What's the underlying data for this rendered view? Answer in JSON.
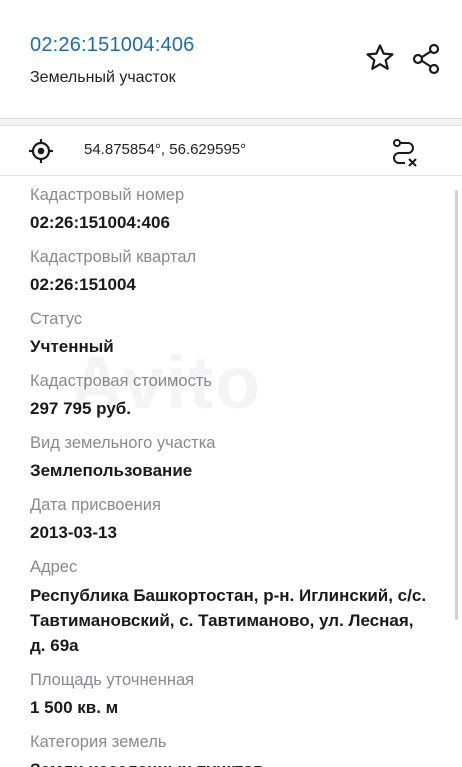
{
  "header": {
    "cadastral_number": "02:26:151004:406",
    "object_type": "Земельный участок"
  },
  "coords": {
    "text": "54.875854°, 56.629595°"
  },
  "fields": [
    {
      "label": "Кадастровый номер",
      "value": "02:26:151004:406"
    },
    {
      "label": "Кадастровый квартал",
      "value": "02:26:151004"
    },
    {
      "label": "Статус",
      "value": "Учтенный"
    },
    {
      "label": "Кадастровая стоимость",
      "value": "297 795 руб."
    },
    {
      "label": "Вид земельного участка",
      "value": "Землепользование"
    },
    {
      "label": "Дата присвоения",
      "value": "2013-03-13"
    },
    {
      "label": "Адрес",
      "value": "Республика Башкортостан, р-н. Иглинский, с/с. Тавтимановский, с. Тавтиманово, ул. Лесная, д. 69а"
    },
    {
      "label": "Площадь уточненная",
      "value": "1 500 кв. м"
    },
    {
      "label": "Категория земель",
      "value": "Земли населенных пунктов"
    }
  ],
  "watermark": "Avito",
  "colors": {
    "link": "#1b6fa8",
    "label": "#8a8a8e",
    "value": "#1a1a1a"
  },
  "icons": [
    "star-icon",
    "share-icon",
    "location-target-icon",
    "route-clear-icon"
  ]
}
